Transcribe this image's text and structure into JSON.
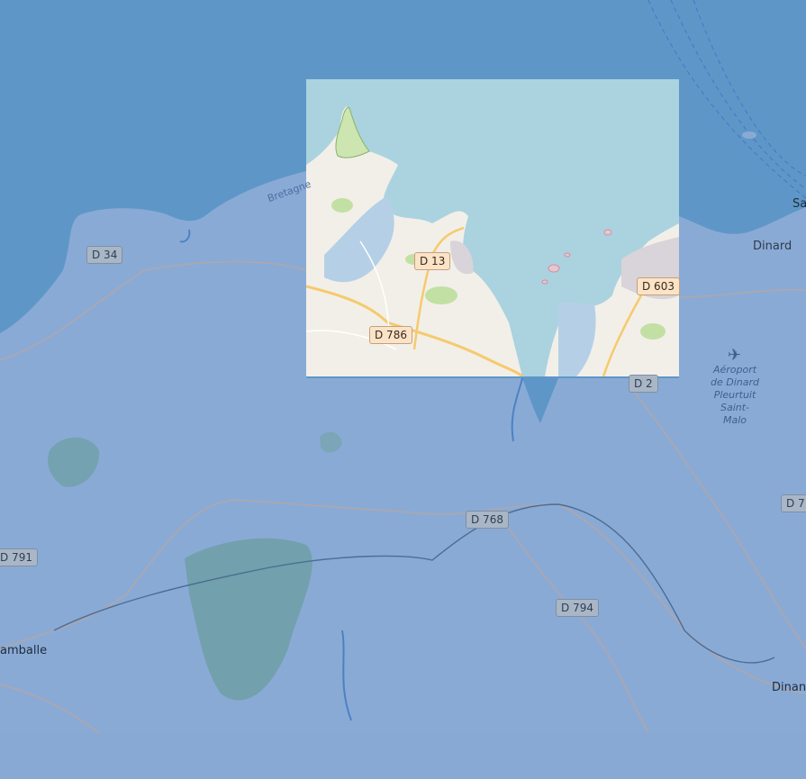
{
  "map": {
    "places": {
      "dinard": "Dinard",
      "lamballe": "amballe",
      "dinan": "Dinan",
      "saint_malo_partial": "Sa",
      "bretagne": "Bretagne",
      "airport": "Aéroport de Dinard Pleurtuit Saint-Malo"
    },
    "roads": {
      "d34": "D 34",
      "d791": "D 791",
      "d768": "D 768",
      "d794": "D 794",
      "d2": "D 2",
      "d7_partial": "D 7",
      "d13": "D 13",
      "d786": "D 786",
      "d603": "D 603"
    }
  },
  "colors": {
    "sea_dark": "#5e97c7",
    "land_overlay": "#8aaad6",
    "tile_sea": "#aad3df",
    "tile_land": "#f2efe9",
    "bottom_bar": "#88a9d3"
  }
}
